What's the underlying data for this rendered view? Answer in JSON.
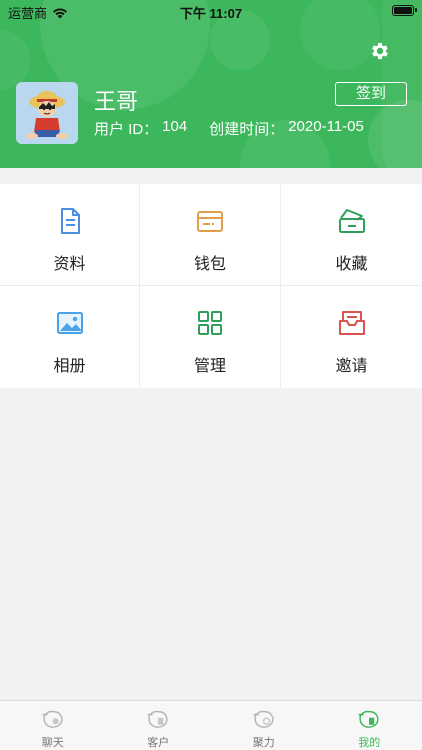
{
  "status_bar": {
    "carrier": "运营商",
    "time": "下午 11:07"
  },
  "profile": {
    "name": "王哥",
    "user_id_label": "用户 ID：",
    "user_id": "104",
    "created_label": "创建时间：",
    "created_date": "2020-11-05",
    "checkin_label": "签到"
  },
  "grid": [
    {
      "label": "资料",
      "icon": "document-icon"
    },
    {
      "label": "钱包",
      "icon": "wallet-icon"
    },
    {
      "label": "收藏",
      "icon": "favorites-box-icon"
    },
    {
      "label": "相册",
      "icon": "photo-album-icon"
    },
    {
      "label": "管理",
      "icon": "grid-manage-icon"
    },
    {
      "label": "邀请",
      "icon": "invite-envelope-icon"
    }
  ],
  "tabs": [
    {
      "label": "聊天",
      "icon": "chat-tab-icon",
      "active": false
    },
    {
      "label": "客户",
      "icon": "customer-tab-icon",
      "active": false
    },
    {
      "label": "聚力",
      "icon": "gather-tab-icon",
      "active": false
    },
    {
      "label": "我的",
      "icon": "mine-tab-icon",
      "active": true
    }
  ],
  "colors": {
    "brand_green": "#3cb75b",
    "doc_blue": "#4a8fe0",
    "wallet_orange": "#e39b4c",
    "manage_green": "#2f9f5a",
    "invite_red": "#d9534f"
  }
}
